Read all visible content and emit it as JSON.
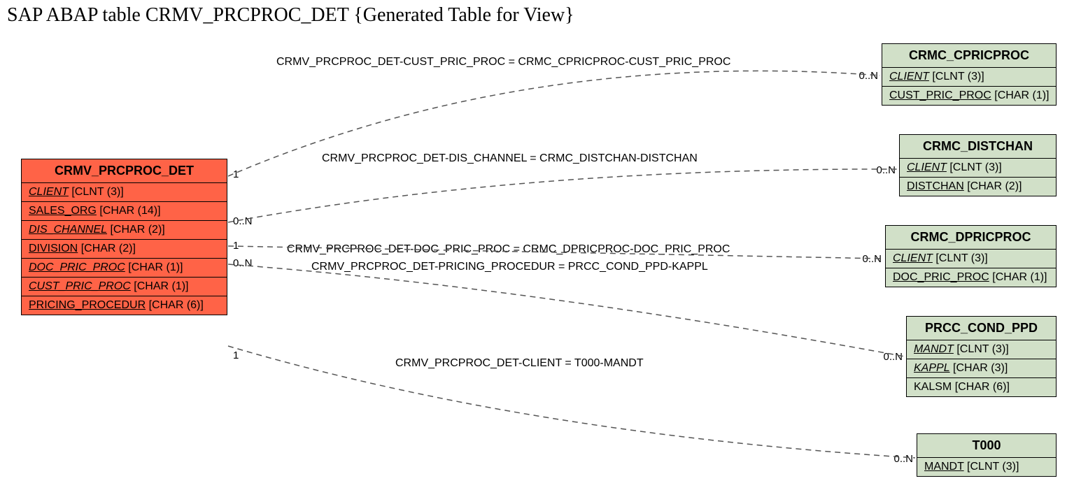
{
  "title": "SAP ABAP table CRMV_PRCPROC_DET {Generated Table for View}",
  "main_entity": {
    "name": "CRMV_PRCPROC_DET",
    "fields": [
      {
        "label": "CLIENT",
        "type": "[CLNT (3)]",
        "key": true
      },
      {
        "label": "SALES_ORG",
        "type": "[CHAR (14)]",
        "key": false
      },
      {
        "label": "DIS_CHANNEL",
        "type": "[CHAR (2)]",
        "key": true
      },
      {
        "label": "DIVISION",
        "type": "[CHAR (2)]",
        "key": false
      },
      {
        "label": "DOC_PRIC_PROC",
        "type": "[CHAR (1)]",
        "key": true
      },
      {
        "label": "CUST_PRIC_PROC",
        "type": "[CHAR (1)]",
        "key": true
      },
      {
        "label": "PRICING_PROCEDUR",
        "type": "[CHAR (6)]",
        "key": false
      }
    ]
  },
  "related": [
    {
      "id": "cpric",
      "name": "CRMC_CPRICPROC",
      "fields": [
        {
          "label": "CLIENT",
          "type": "[CLNT (3)]",
          "key": true
        },
        {
          "label": "CUST_PRIC_PROC",
          "type": "[CHAR (1)]",
          "key": false,
          "fk": true
        }
      ],
      "rel_text": "CRMV_PRCPROC_DET-CUST_PRIC_PROC = CRMC_CPRICPROC-CUST_PRIC_PROC",
      "left_card": "1",
      "right_card": "0..N"
    },
    {
      "id": "distchan",
      "name": "CRMC_DISTCHAN",
      "fields": [
        {
          "label": "CLIENT",
          "type": "[CLNT (3)]",
          "key": true
        },
        {
          "label": "DISTCHAN",
          "type": "[CHAR (2)]",
          "key": false,
          "fk": true
        }
      ],
      "rel_text": "CRMV_PRCPROC_DET-DIS_CHANNEL = CRMC_DISTCHAN-DISTCHAN",
      "left_card": "0..N",
      "right_card": "0..N"
    },
    {
      "id": "dpric",
      "name": "CRMC_DPRICPROC",
      "fields": [
        {
          "label": "CLIENT",
          "type": "[CLNT (3)]",
          "key": true
        },
        {
          "label": "DOC_PRIC_PROC",
          "type": "[CHAR (1)]",
          "key": false,
          "fk": true
        }
      ],
      "rel_text": "CRMV_PRCPROC_DET-DOC_PRIC_PROC = CRMC_DPRICPROC-DOC_PRIC_PROC",
      "left_card": "1",
      "right_card": "0..N"
    },
    {
      "id": "prcc",
      "name": "PRCC_COND_PPD",
      "fields": [
        {
          "label": "MANDT",
          "type": "[CLNT (3)]",
          "key": true
        },
        {
          "label": "KAPPL",
          "type": "[CHAR (3)]",
          "key": true
        },
        {
          "label": "KALSM",
          "type": "[CHAR (6)]",
          "key": false
        }
      ],
      "rel_text": "CRMV_PRCPROC_DET-PRICING_PROCEDUR = PRCC_COND_PPD-KAPPL",
      "left_card": "0..N",
      "right_card": "0..N"
    },
    {
      "id": "t000",
      "name": "T000",
      "fields": [
        {
          "label": "MANDT",
          "type": "[CLNT (3)]",
          "key": false,
          "fk": true
        }
      ],
      "rel_text": "CRMV_PRCPROC_DET-CLIENT = T000-MANDT",
      "left_card": "1",
      "right_card": "0..N"
    }
  ]
}
